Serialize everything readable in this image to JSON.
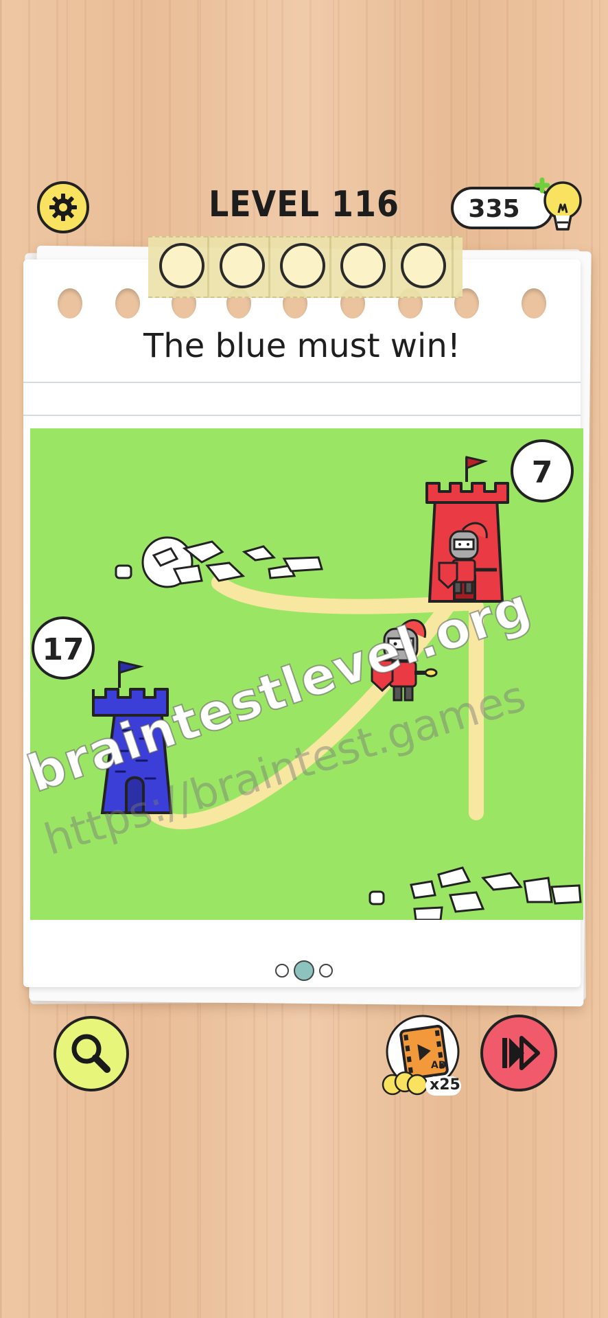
{
  "header": {
    "level_title": "LEVEL 116",
    "hint_count": "335"
  },
  "progress": {
    "slots_total": 5,
    "slots_filled": 0
  },
  "puzzle": {
    "prompt": "The blue must win!",
    "blue_tower": {
      "count": "17",
      "color": "#3b3fd8"
    },
    "red_tower": {
      "count": "7",
      "color": "#ea3a43"
    },
    "grass_color": "#9be565",
    "path_color": "#f7e7a0"
  },
  "pagination": {
    "pages": 3,
    "current": 2
  },
  "footer": {
    "ad_label": "AD",
    "ad_cost": "x25"
  },
  "watermark": {
    "primary": "braintestlevel.org",
    "secondary": "https://braintest.games"
  },
  "icons": {
    "settings": "gear-icon",
    "hint": "lightbulb-icon",
    "zoom": "magnifier-icon",
    "watch_ad": "film-icon",
    "skip": "fast-forward-icon"
  }
}
